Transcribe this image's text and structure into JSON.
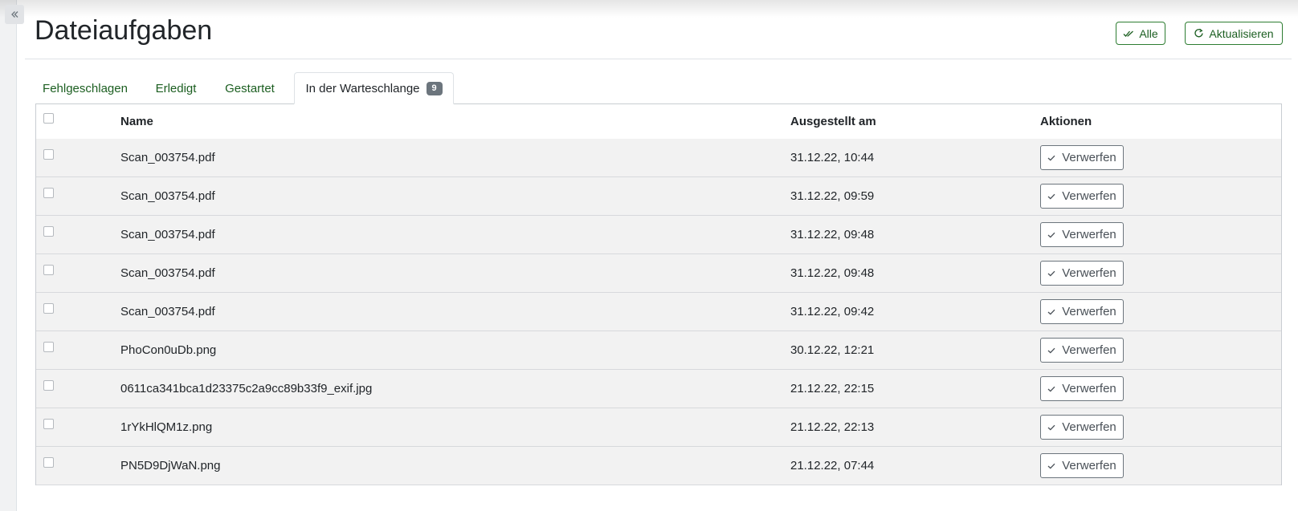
{
  "page": {
    "title": "Dateiaufgaben"
  },
  "header": {
    "all_label": "Alle",
    "refresh_label": "Aktualisieren"
  },
  "tabs": [
    {
      "label": "Fehlgeschlagen",
      "active": false
    },
    {
      "label": "Erledigt",
      "active": false
    },
    {
      "label": "Gestartet",
      "active": false
    },
    {
      "label": "In der Warteschlange",
      "active": true,
      "count": "9"
    }
  ],
  "table": {
    "headers": {
      "name": "Name",
      "issued": "Ausgestellt am",
      "actions": "Aktionen"
    },
    "action_label": "Verwerfen",
    "rows": [
      {
        "name": "Scan_003754.pdf",
        "issued": "31.12.22, 10:44"
      },
      {
        "name": "Scan_003754.pdf",
        "issued": "31.12.22, 09:59"
      },
      {
        "name": "Scan_003754.pdf",
        "issued": "31.12.22, 09:48"
      },
      {
        "name": "Scan_003754.pdf",
        "issued": "31.12.22, 09:48"
      },
      {
        "name": "Scan_003754.pdf",
        "issued": "31.12.22, 09:42"
      },
      {
        "name": "PhoCon0uDb.png",
        "issued": "30.12.22, 12:21"
      },
      {
        "name": "0611ca341bca1d23375c2a9cc89b33f9_exif.jpg",
        "issued": "21.12.22, 22:15"
      },
      {
        "name": "1rYkHlQM1z.png",
        "issued": "21.12.22, 22:13"
      },
      {
        "name": "PN5D9DjWaN.png",
        "issued": "21.12.22, 07:44"
      }
    ]
  },
  "icons": {
    "collapse": "double-chevron-left-icon",
    "all": "double-check-icon",
    "refresh": "refresh-icon",
    "discard": "check-icon"
  },
  "colors": {
    "accent": "#1b5e20",
    "accent_border": "#2e7d32",
    "badge": "#6c757d",
    "row_bg": "#f2f2f2"
  }
}
